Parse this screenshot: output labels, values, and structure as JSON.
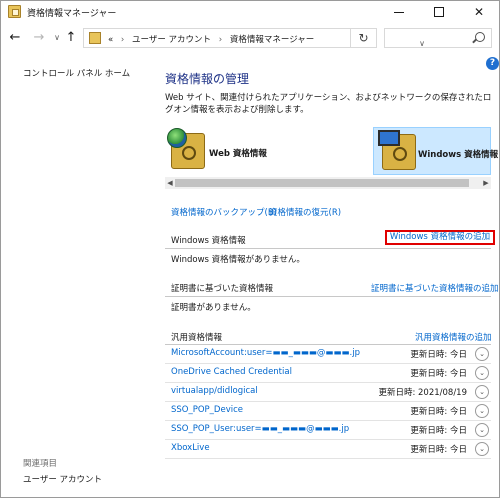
{
  "window": {
    "title": "資格情報マネージャー",
    "minimize": "—",
    "maximize": "□",
    "close": "✕"
  },
  "nav": {
    "back": "←",
    "forward": "→",
    "dropdown": "∨",
    "up": "↑",
    "address_prefix": "«",
    "breadcrumb_1": "ユーザー アカウント",
    "breadcrumb_sep": "›",
    "breadcrumb_2": "資格情報マネージャー",
    "address_dropdown": "∨",
    "refresh": "↻"
  },
  "sidebar": {
    "control_panel_home": "コントロール パネル ホーム",
    "related_title": "関連項目",
    "user_accounts": "ユーザー アカウント"
  },
  "help": "?",
  "main": {
    "title": "資格情報の管理",
    "description": "Web サイト、関連付けられたアプリケーション、およびネットワークの保存されたログオン情報を表示および削除します。",
    "web_credentials_label": "Web 資格情報",
    "windows_credentials_label": "Windows 資格情報",
    "scroll_left": "◀",
    "scroll_right": "▶",
    "backup_link": "資格情報のバックアップ(B)",
    "restore_link": "資格情報の復元(R)"
  },
  "sections": {
    "windows": {
      "title": "Windows 資格情報",
      "add": "Windows 資格情報の追加",
      "empty": "Windows 資格情報がありません。"
    },
    "certificate": {
      "title": "証明書に基づいた資格情報",
      "add": "証明書に基づいた資格情報の追加",
      "empty": "証明書がありません。"
    },
    "generic": {
      "title": "汎用資格情報",
      "add": "汎用資格情報の追加",
      "items": [
        {
          "name": "MicrosoftAccount:user=▬▬_▬▬▬@▬▬▬.jp",
          "modified": "更新日時: 今日"
        },
        {
          "name": "OneDrive Cached Credential",
          "modified": "更新日時: 今日"
        },
        {
          "name": "virtualapp/didlogical",
          "modified": "更新日時: 2021/08/19"
        },
        {
          "name": "SSO_POP_Device",
          "modified": "更新日時: 今日"
        },
        {
          "name": "SSO_POP_User:user=▬▬_▬▬▬@▬▬▬.jp",
          "modified": "更新日時: 今日"
        },
        {
          "name": "XboxLive",
          "modified": "更新日時: 今日"
        }
      ],
      "expand": "⌄"
    }
  },
  "colors": {
    "accent_blue": "#0066cc",
    "title_blue": "#1e3287",
    "highlight_red": "#e00000",
    "selected_bg": "#cce8ff"
  }
}
